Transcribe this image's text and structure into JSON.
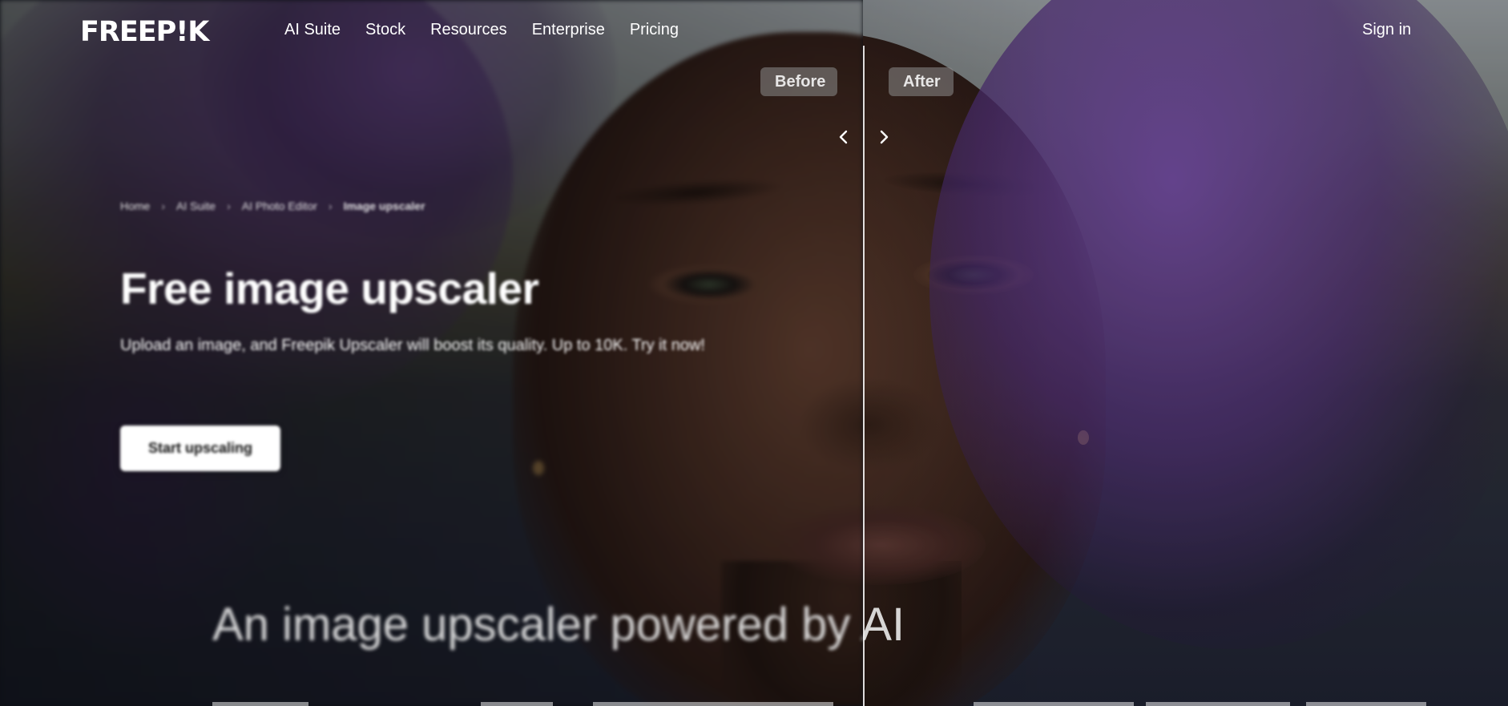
{
  "brand": {
    "logo_text": "FREEP!K"
  },
  "nav": {
    "items": [
      "AI Suite",
      "Stock",
      "Resources",
      "Enterprise",
      "Pricing"
    ],
    "sign_in": "Sign in"
  },
  "comparison": {
    "before_label": "Before",
    "after_label": "After",
    "left_arrow_icon": "chevron-left-icon",
    "right_arrow_icon": "chevron-right-icon"
  },
  "breadcrumb": {
    "items": [
      "Home",
      "AI Suite",
      "AI Photo Editor",
      "Image upscaler"
    ],
    "separator": "›"
  },
  "hero": {
    "title": "Free image upscaler",
    "subtitle": "Upload an image, and Freepik Upscaler will boost its quality. Up to 10K. Try it now!",
    "cta": "Start upscaling"
  },
  "section": {
    "title": "An image upscaler powered by AI"
  },
  "colors": {
    "hair_accent": "#784eaa",
    "text": "#ffffff",
    "cta_bg": "#ffffff"
  }
}
